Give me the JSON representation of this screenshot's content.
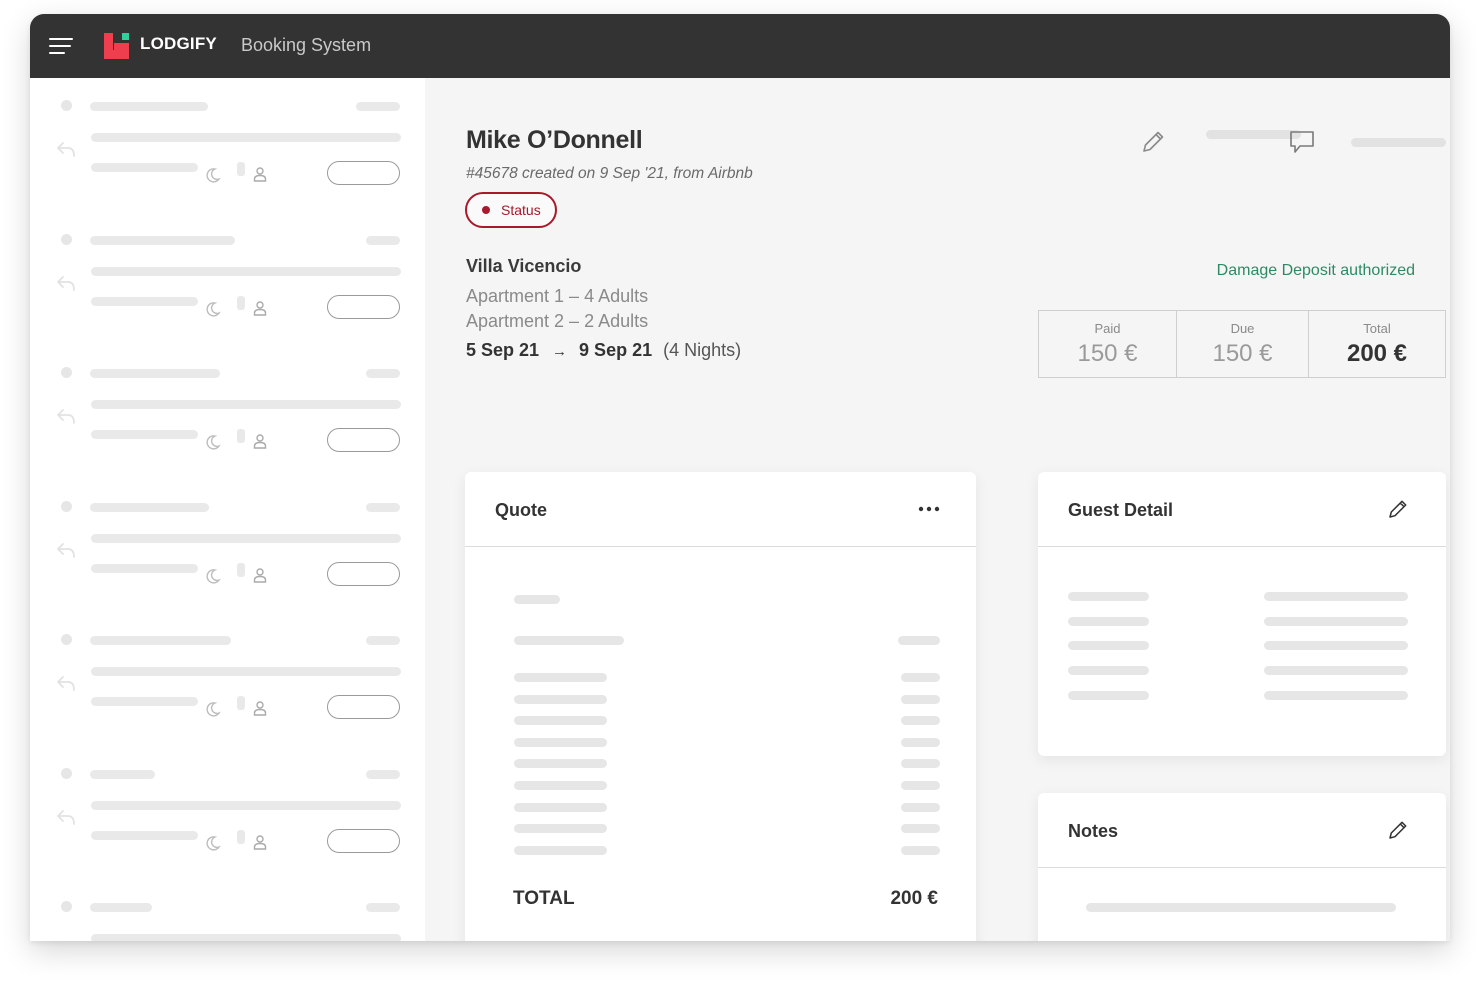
{
  "header": {
    "brand": "LODGIFY",
    "app_title": "Booking System"
  },
  "booking": {
    "guest_name": "Mike O’Donnell",
    "meta": "#45678 created on 9 Sep '21, from Airbnb",
    "status_label": "Status",
    "property": "Villa Vicencio",
    "apartments": [
      "Apartment 1 – 4 Adults",
      "Apartment 2 – 2 Adults"
    ],
    "check_in": "5 Sep 21",
    "check_out": "9 Sep 21",
    "nights": "(4 Nights)",
    "deposit_status": "Damage Deposit authorized"
  },
  "amounts": {
    "paid_label": "Paid",
    "paid_value": "150 €",
    "due_label": "Due",
    "due_value": "150 €",
    "total_label": "Total",
    "total_value": "200 €"
  },
  "quote": {
    "title": "Quote",
    "total_label": "TOTAL",
    "total_value": "200 €"
  },
  "guest_detail": {
    "title": "Guest Detail"
  },
  "notes": {
    "title": "Notes"
  },
  "colors": {
    "topbar": "#333333",
    "brand_red": "#ef3f4e",
    "brand_green": "#2fd09c",
    "status": "#a8192b",
    "deposit": "#2e8a64"
  },
  "icons": [
    "menu-icon",
    "pencil-icon",
    "comment-icon",
    "reply-icon",
    "moon-icon",
    "person-icon",
    "more-icon"
  ]
}
